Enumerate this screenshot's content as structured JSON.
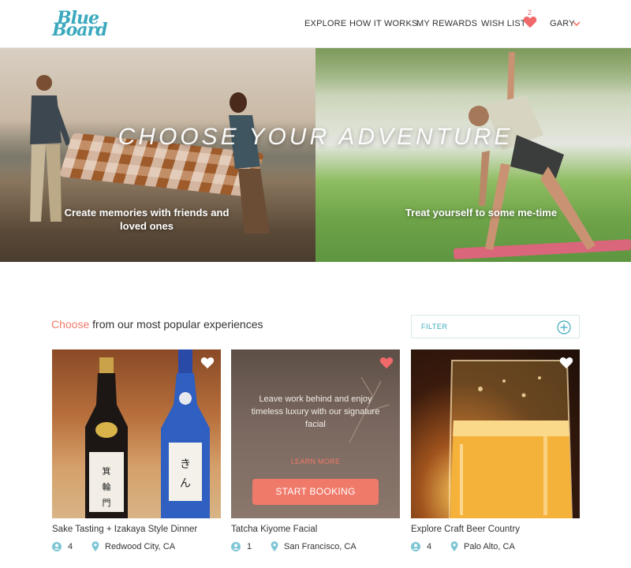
{
  "brand": {
    "logo_line1": "Blue",
    "logo_line2": "Board",
    "color": "#3aa9be"
  },
  "nav": {
    "explore": "EXPLORE",
    "how_it_works": "HOW IT WORKS",
    "my_rewards": "MY REWARDS",
    "wish_list": "WISH LIST",
    "wish_count": "2",
    "user": "GARY"
  },
  "hero": {
    "title": "CHOOSE YOUR ADVENTURE",
    "left_caption": "Create memories with friends and loved ones",
    "right_caption": "Treat yourself to some me-time"
  },
  "section": {
    "title_accent": "Choose",
    "title_rest": " from our most popular experiences",
    "filter_label": "FILTER"
  },
  "cards": [
    {
      "title": "Sake Tasting + Izakaya Style Dinner",
      "people": "4",
      "location": "Redwood City, CA",
      "wishlisted": false
    },
    {
      "title": "Tatcha Kiyome Facial",
      "people": "1",
      "location": "San Francisco, CA",
      "wishlisted": true,
      "hover_text": "Leave work behind and enjoy timeless luxury with our signature facial",
      "learn_more": "LEARN MORE",
      "cta": "START BOOKING"
    },
    {
      "title": "Explore Craft Beer Country",
      "people": "4",
      "location": "Palo Alto, CA",
      "wishlisted": false
    }
  ],
  "colors": {
    "accent": "#f07a6a",
    "teal": "#3aa9be",
    "heart": "#f0696b"
  }
}
